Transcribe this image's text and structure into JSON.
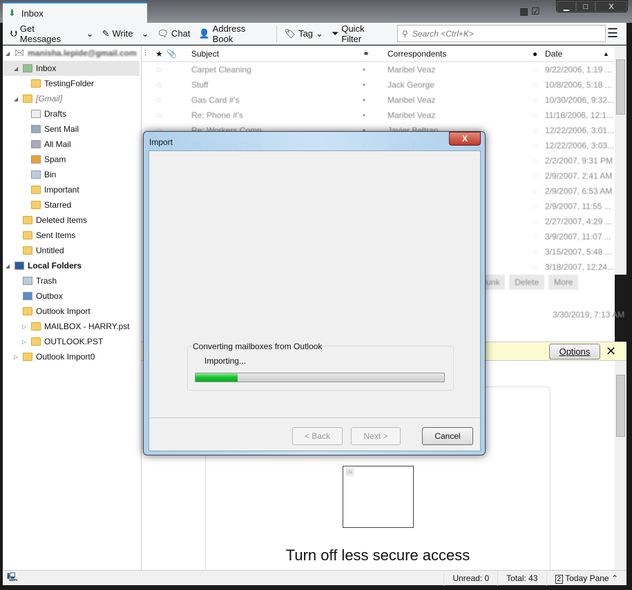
{
  "window": {
    "tab_title": "Inbox",
    "controls": [
      "▁",
      "□",
      "X"
    ]
  },
  "toolbar": {
    "get_messages": "Get Messages",
    "write": "Write",
    "chat": "Chat",
    "address_book": "Address Book",
    "tag": "Tag",
    "quick_filter": "Quick Filter",
    "search_placeholder": "Search <Ctrl+K>"
  },
  "folders": {
    "account": "manisha.lepide@gmail.com",
    "items": [
      {
        "label": "Inbox",
        "indent": 1,
        "icon": "inbox-icon",
        "selected": true
      },
      {
        "label": "TestingFolder",
        "indent": 2,
        "icon": "folder-icon"
      },
      {
        "label": "[Gmail]",
        "indent": 1,
        "icon": "folder-icon",
        "italic": true
      },
      {
        "label": "Drafts",
        "indent": 2,
        "icon": "drafts-icon"
      },
      {
        "label": "Sent Mail",
        "indent": 2,
        "icon": "sent-icon"
      },
      {
        "label": "All Mail",
        "indent": 2,
        "icon": "archive-icon"
      },
      {
        "label": "Spam",
        "indent": 2,
        "icon": "spam-icon"
      },
      {
        "label": "Bin",
        "indent": 2,
        "icon": "trash-icon"
      },
      {
        "label": "Important",
        "indent": 2,
        "icon": "folder-icon"
      },
      {
        "label": "Starred",
        "indent": 2,
        "icon": "folder-icon"
      },
      {
        "label": "Deleted Items",
        "indent": 1,
        "icon": "folder-icon"
      },
      {
        "label": "Sent Items",
        "indent": 1,
        "icon": "folder-icon"
      },
      {
        "label": "Untitled",
        "indent": 1,
        "icon": "folder-icon"
      },
      {
        "label": "Local Folders",
        "indent": 0,
        "icon": "computer-icon",
        "bold": true
      },
      {
        "label": "Trash",
        "indent": 1,
        "icon": "trash-icon"
      },
      {
        "label": "Outbox",
        "indent": 1,
        "icon": "outbox-icon"
      },
      {
        "label": "Outlook Import",
        "indent": 1,
        "icon": "folder-icon"
      },
      {
        "label": "MAILBOX - HARRY.pst",
        "indent": 2,
        "icon": "folder-icon"
      },
      {
        "label": "OUTLOOK.PST",
        "indent": 2,
        "icon": "folder-icon"
      },
      {
        "label": "Outlook Import0",
        "indent": 1,
        "icon": "folder-icon"
      }
    ]
  },
  "list": {
    "headers": {
      "subject": "Subject",
      "correspondents": "Correspondents",
      "date": "Date"
    },
    "rows": [
      {
        "subject": "Carpet Cleaning",
        "from": "Maribel Veaz",
        "date": "9/22/2006, 1:19 ..."
      },
      {
        "subject": "Stuff",
        "from": "Jack George",
        "date": "10/8/2006, 5:18 ..."
      },
      {
        "subject": "Gas Card #'s",
        "from": "Maribel Veaz",
        "date": "10/30/2006, 9:32..."
      },
      {
        "subject": "Re: Phone #'s",
        "from": "Maribel Veaz",
        "date": "11/18/2006, 12:1..."
      },
      {
        "subject": "Re: Workers Comp",
        "from": "Javier Beltran",
        "date": "12/22/2006, 3:01..."
      },
      {
        "subject": "Re: Workers Comp",
        "from": "Javier Beltran",
        "date": "12/22/2006, 3:03..."
      },
      {
        "subject": "",
        "from": "",
        "date": "2/2/2007, 9:31 PM"
      },
      {
        "subject": "",
        "from": "",
        "date": "2/9/2007, 2:41 AM"
      },
      {
        "subject": "",
        "from": "",
        "date": "2/9/2007, 6:53 AM"
      },
      {
        "subject": "",
        "from": "",
        "date": "2/9/2007, 11:55 ..."
      },
      {
        "subject": "",
        "from": "",
        "date": "2/27/2007, 4:29 ..."
      },
      {
        "subject": "",
        "from": "",
        "date": "3/9/2007, 11:07 ..."
      },
      {
        "subject": "",
        "from": "",
        "date": "3/15/2007, 5:48 ..."
      },
      {
        "subject": "",
        "from": "",
        "date": "3/18/2007, 12:24..."
      }
    ]
  },
  "message": {
    "junk": "Junk",
    "delete": "Delete",
    "more": "More",
    "date": "3/30/2019, 7:13 AM",
    "options": "Options",
    "heading": "Turn off less secure access"
  },
  "status": {
    "unread": "Unread: 0",
    "total": "Total: 43",
    "today_pane": "Today Pane",
    "today_day": "2"
  },
  "dialog": {
    "title": "Import",
    "group_label": "Converting mailboxes from Outlook",
    "status": "Importing...",
    "progress_percent": 17,
    "back": "< Back",
    "next": "Next >",
    "cancel": "Cancel",
    "progress_color": "#14c02c"
  }
}
